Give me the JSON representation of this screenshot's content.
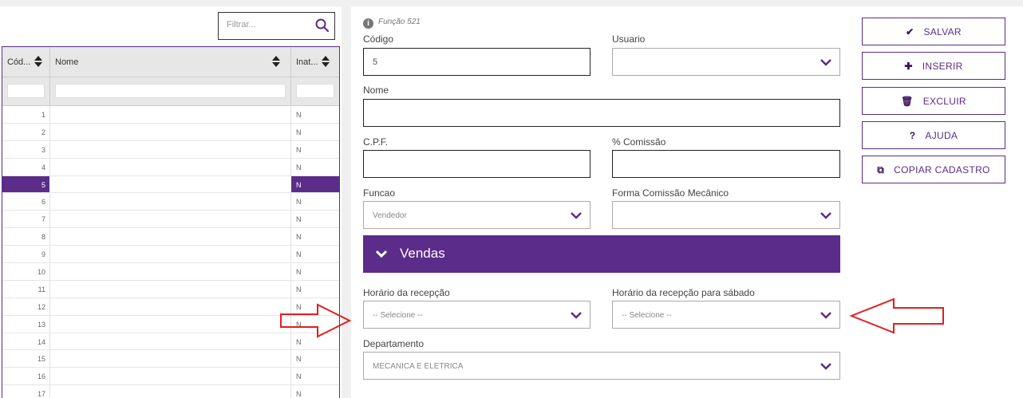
{
  "filter": {
    "placeholder": "Filtrar..."
  },
  "grid": {
    "columns": [
      "Cód...",
      "Nome",
      "Inat..."
    ],
    "rows": [
      {
        "code": "1",
        "inactive": "N"
      },
      {
        "code": "2",
        "inactive": "N"
      },
      {
        "code": "3",
        "inactive": "N"
      },
      {
        "code": "4",
        "inactive": "N"
      },
      {
        "code": "5",
        "inactive": "N"
      },
      {
        "code": "6",
        "inactive": "N"
      },
      {
        "code": "7",
        "inactive": "N"
      },
      {
        "code": "8",
        "inactive": "N"
      },
      {
        "code": "9",
        "inactive": "N"
      },
      {
        "code": "10",
        "inactive": "N"
      },
      {
        "code": "11",
        "inactive": "N"
      },
      {
        "code": "12",
        "inactive": "N"
      },
      {
        "code": "13",
        "inactive": "N"
      },
      {
        "code": "14",
        "inactive": "N"
      },
      {
        "code": "15",
        "inactive": "N"
      },
      {
        "code": "16",
        "inactive": "N"
      },
      {
        "code": "17",
        "inactive": "N"
      }
    ],
    "selected_code": "5"
  },
  "form": {
    "function_info": "Função 521",
    "codigo_label": "Código",
    "codigo_value": "5",
    "usuario_label": "Usuario",
    "usuario_value": "",
    "nome_label": "Nome",
    "nome_value": "",
    "cpf_label": "C.P.F.",
    "cpf_value": "",
    "comissao_label": "% Comissão",
    "comissao_value": "",
    "funcao_label": "Funcao",
    "funcao_value": "Vendedor",
    "forma_comissao_label": "Forma Comissão Mecânico",
    "forma_comissao_value": "",
    "section_title": "Vendas",
    "horario_label": "Horário da recepção",
    "horario_value": "-- Selecione --",
    "horario_sabado_label": "Horário da recepção para sábado",
    "horario_sabado_value": "-- Selecione --",
    "departamento_label": "Departamento",
    "departamento_value": "MECANICA E ELETRICA"
  },
  "buttons": {
    "salvar": "SALVAR",
    "inserir": "INSERIR",
    "excluir": "EXCLUIR",
    "ajuda": "AJUDA",
    "copiar": "COPIAR CADASTRO"
  },
  "colors": {
    "accent": "#5b2c8a",
    "annotation": "#e02020"
  }
}
